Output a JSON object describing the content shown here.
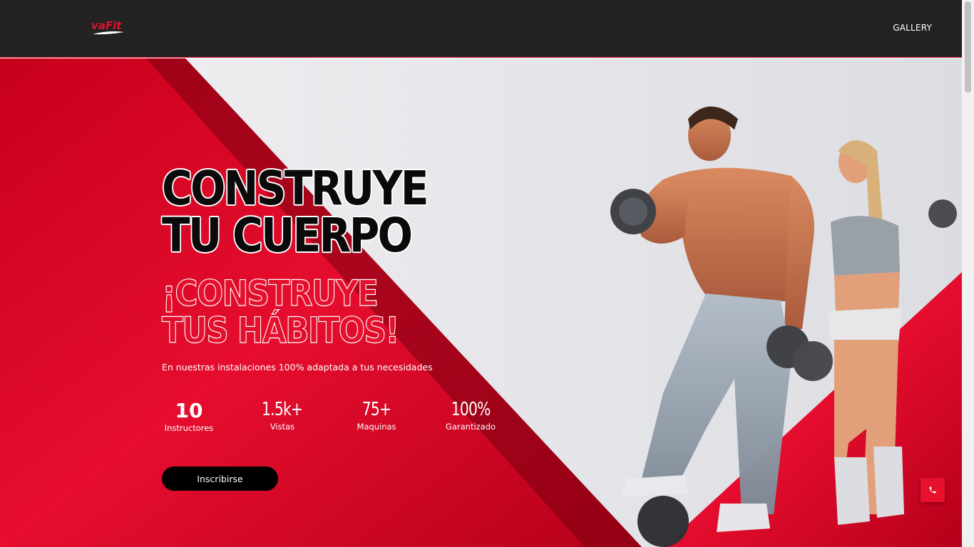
{
  "brand": {
    "logo_text": "vaFit"
  },
  "nav": {
    "items": [
      {
        "label": "GALLERY"
      }
    ]
  },
  "hero": {
    "headline": "CONSTRUYE TU CUERPO",
    "subheadline": "¡CONSTRUYE TUS HÁBITOS!",
    "description": "En nuestras instalaciones 100% adaptada a tus necesidades",
    "stats": [
      {
        "value": "10",
        "label": "Instructores"
      },
      {
        "value": "1.5k+",
        "label": "Vistas"
      },
      {
        "value": "75+",
        "label": "Maquinas"
      },
      {
        "value": "100%",
        "label": "Garantizado"
      }
    ],
    "cta_label": "Inscribirse"
  },
  "floating": {
    "phone_icon": "phone-icon"
  },
  "colors": {
    "accent": "#e4102e",
    "navbar": "#222222",
    "cta": "#000000"
  }
}
